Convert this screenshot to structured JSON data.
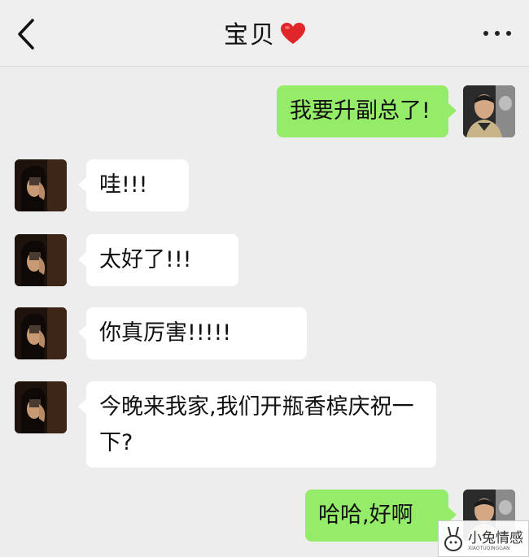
{
  "header": {
    "title": "宝贝",
    "heart_icon": "red-heart-icon"
  },
  "messages": [
    {
      "from": "me",
      "text": "我要升副总了!"
    },
    {
      "from": "her",
      "text": "哇!!!"
    },
    {
      "from": "her",
      "text": "太好了!!!"
    },
    {
      "from": "her",
      "text": "你真厉害!!!!!"
    },
    {
      "from": "her",
      "text": "今晚来我家,我们开瓶香槟庆祝一下?"
    },
    {
      "from": "me",
      "text": "哈哈,好啊"
    }
  ],
  "watermark": {
    "text": "小兔情感",
    "subtext": "XIAOTUQINGGAN"
  },
  "colors": {
    "outgoing_bubble": "#95ec69",
    "incoming_bubble": "#ffffff",
    "background": "#ededed"
  }
}
